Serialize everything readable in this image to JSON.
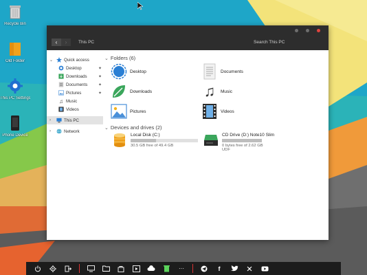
{
  "desktop": {
    "icons": [
      {
        "label": "Recycle Bin",
        "icon": "recycle-bin-icon"
      },
      {
        "label": "Old Folder",
        "icon": "folder-icon"
      },
      {
        "label": "This PC Settings",
        "icon": "gear-icon"
      },
      {
        "label": "Phone Device",
        "icon": "phone-icon"
      }
    ]
  },
  "window": {
    "address": "This PC",
    "search_placeholder": "Search This PC",
    "controls": [
      {
        "name": "minimize",
        "color": "#6e6e6e"
      },
      {
        "name": "maximize",
        "color": "#6e6e6e"
      },
      {
        "name": "close",
        "color": "#e0443e"
      }
    ]
  },
  "sidebar": {
    "items": [
      {
        "label": "Quick access",
        "icon": "star-icon",
        "chevron": "⌄",
        "pinned": false,
        "selected": false,
        "indent": false
      },
      {
        "label": "Desktop",
        "icon": "desktop-icon",
        "pinned": true,
        "selected": false,
        "indent": true
      },
      {
        "label": "Downloads",
        "icon": "download-icon",
        "pinned": true,
        "selected": false,
        "indent": true
      },
      {
        "label": "Documents",
        "icon": "document-icon",
        "pinned": true,
        "selected": false,
        "indent": true
      },
      {
        "label": "Pictures",
        "icon": "picture-icon",
        "pinned": true,
        "selected": false,
        "indent": true
      },
      {
        "label": "Music",
        "icon": "music-icon",
        "pinned": false,
        "selected": false,
        "indent": true
      },
      {
        "label": "Videos",
        "icon": "video-icon",
        "pinned": false,
        "selected": false,
        "indent": true
      },
      {
        "label": "This PC",
        "icon": "computer-icon",
        "chevron": "›",
        "pinned": false,
        "selected": true,
        "indent": false
      },
      {
        "label": "Network",
        "icon": "network-icon",
        "chevron": "›",
        "pinned": false,
        "selected": false,
        "indent": false
      }
    ]
  },
  "main": {
    "folders_heading": "Folders (6)",
    "folders": [
      {
        "name": "Desktop",
        "icon": "desktop-folder-icon"
      },
      {
        "name": "Documents",
        "icon": "documents-folder-icon"
      },
      {
        "name": "Downloads",
        "icon": "downloads-folder-icon"
      },
      {
        "name": "Music",
        "icon": "music-folder-icon"
      },
      {
        "name": "Pictures",
        "icon": "pictures-folder-icon"
      },
      {
        "name": "Videos",
        "icon": "videos-folder-icon"
      }
    ],
    "drives_heading": "Devices and drives (2)",
    "drives": [
      {
        "name": "Local Disk (C:)",
        "free": "30.5 GB free of 49.4 GB",
        "used_fraction": 0.38,
        "fs": "",
        "icon": "hard-disk-icon"
      },
      {
        "name": "CD Drive (D:) Note10 Slim",
        "free": "0 bytes free of 2.62 GB",
        "used_fraction": 1.0,
        "fs": "UDF",
        "icon": "cd-drive-icon"
      }
    ]
  },
  "taskbar": {
    "groups": [
      [
        "power-icon",
        "settings-icon",
        "logout-icon"
      ],
      [
        "monitor-icon",
        "folder-icon",
        "store-icon",
        "media-icon",
        "cloud-icon",
        "trash-icon",
        "more-icon"
      ],
      [
        "telegram-icon",
        "facebook-icon",
        "twitter-icon",
        "apps-icon",
        "youtube-icon"
      ]
    ]
  },
  "colors": {
    "titlebar": "#2d2d2d",
    "accent": "#2a7fd4",
    "taskbar": "#1c1c1c",
    "separator": "#dd3333"
  }
}
